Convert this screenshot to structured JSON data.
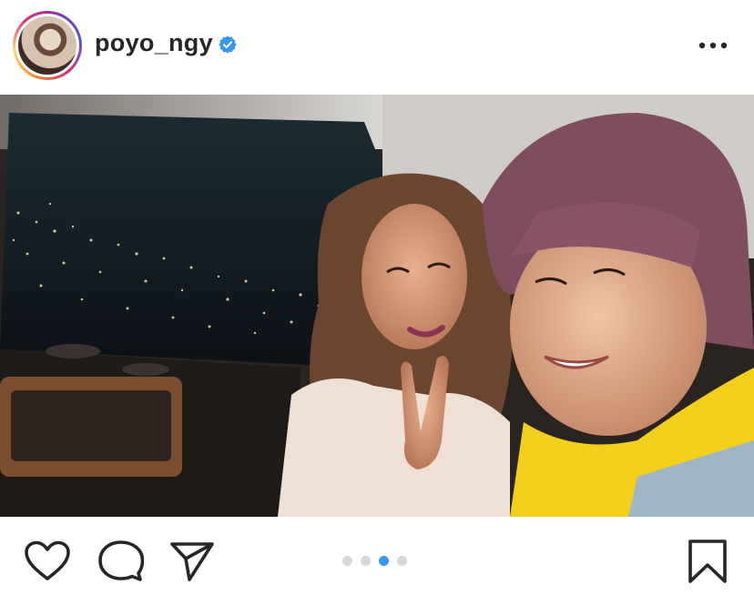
{
  "post": {
    "username": "poyo_ngy",
    "verified": true,
    "more_icon": "more-horizontal-icon"
  },
  "photo": {
    "description_icon": "photo"
  },
  "actions": {
    "like_icon": "heart-icon",
    "comment_icon": "comment-icon",
    "share_icon": "share-icon",
    "save_icon": "bookmark-icon"
  },
  "carousel": {
    "total": 4,
    "active_index": 2
  },
  "colors": {
    "text": "#262626",
    "verified_badge": "#3897f0",
    "active_dot": "#3897f0",
    "inactive_dot": "#d8d8d8"
  }
}
